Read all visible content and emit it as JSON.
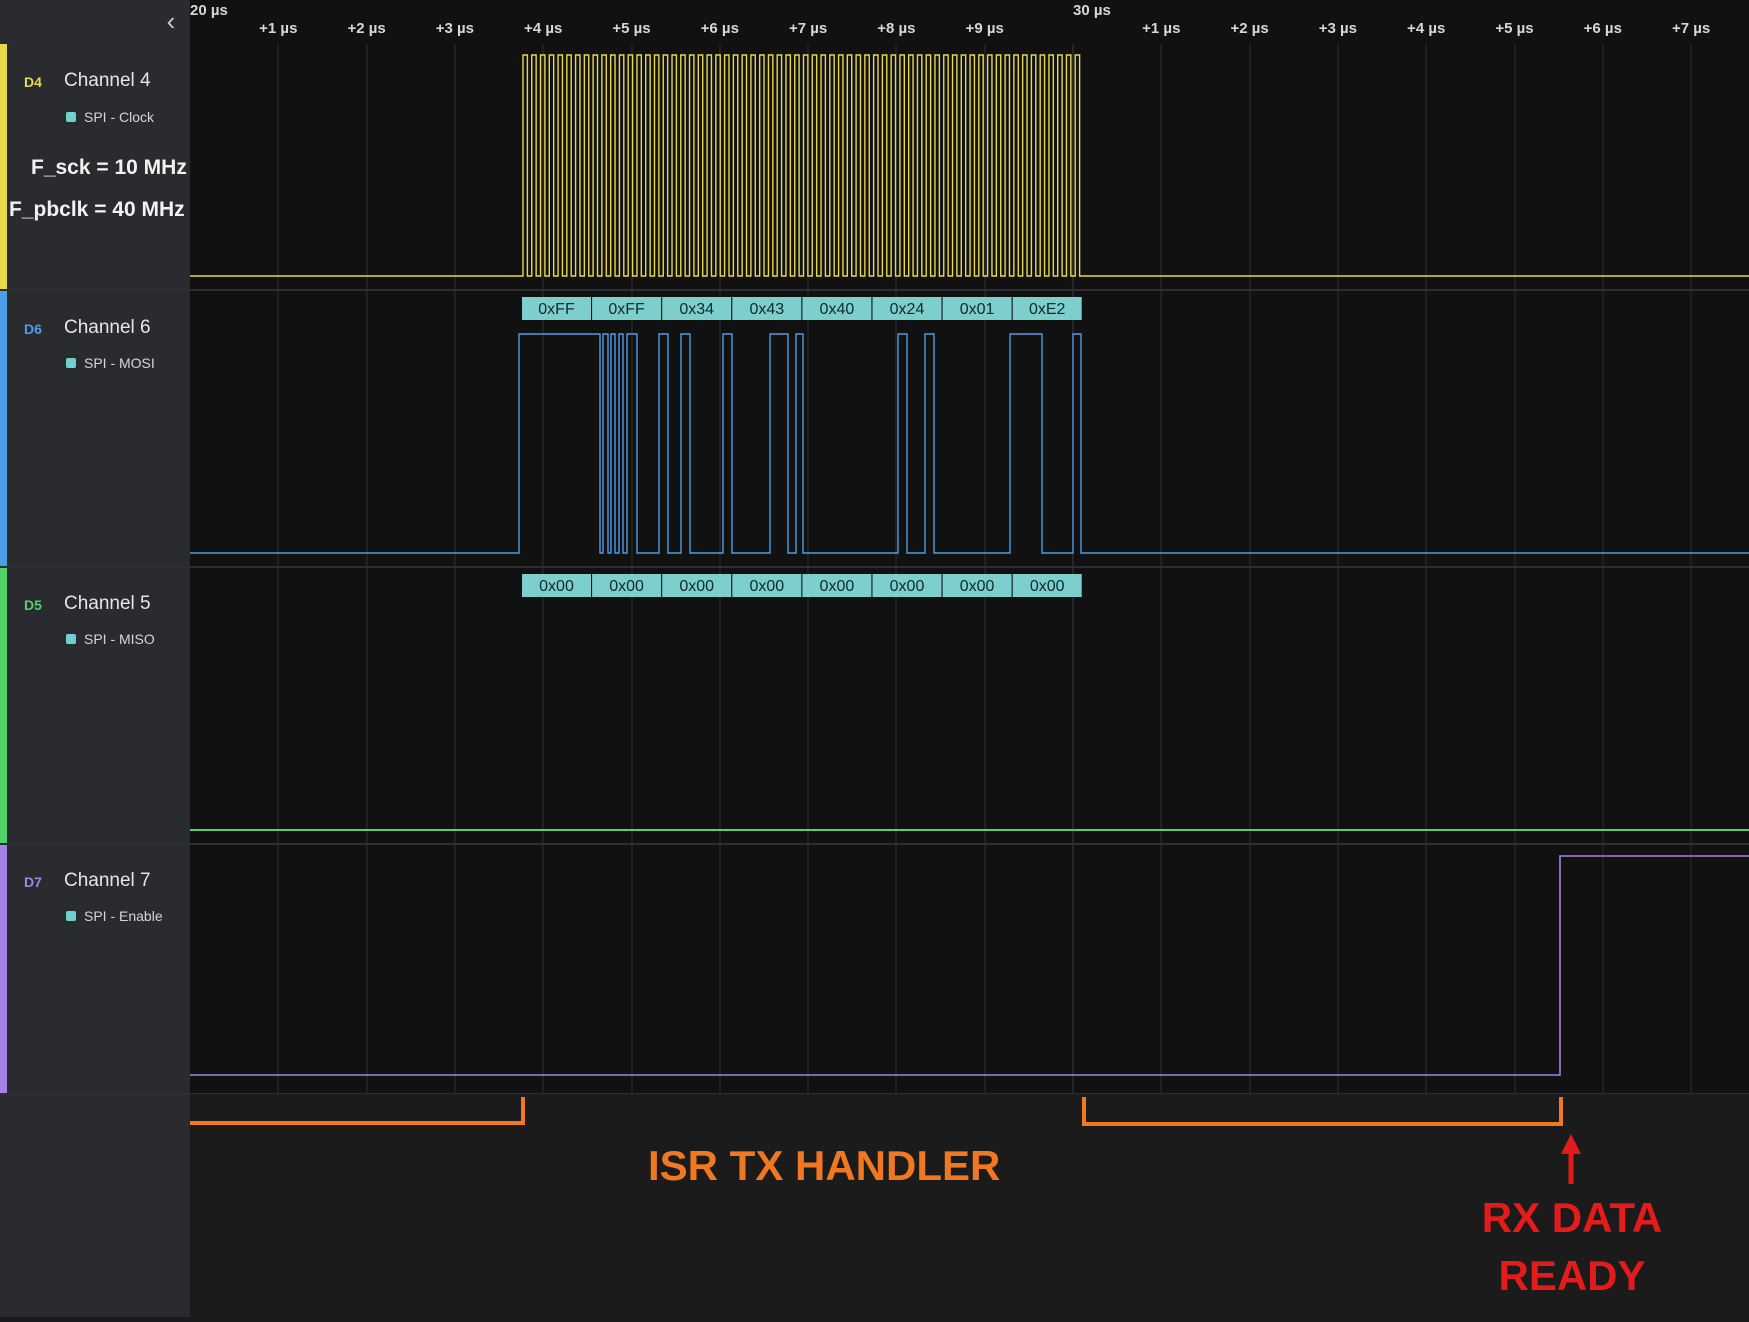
{
  "timeline": {
    "major_labels": [
      "20 µs",
      "30 µs"
    ],
    "minor_labels": [
      "+1 µs",
      "+2 µs",
      "+3 µs",
      "+4 µs",
      "+5 µs",
      "+6 µs",
      "+7 µs",
      "+8 µs",
      "+9 µs",
      "+1 µs",
      "+2 µs",
      "+3 µs",
      "+4 µs",
      "+5 µs",
      "+6 µs",
      "+7 µs"
    ]
  },
  "channels": [
    {
      "tag": "D4",
      "name": "Channel 4",
      "subtitle": "SPI - Clock",
      "color": "#e8d84a"
    },
    {
      "tag": "D6",
      "name": "Channel 6",
      "subtitle": "SPI - MOSI",
      "color": "#4e9de6"
    },
    {
      "tag": "D5",
      "name": "Channel 5",
      "subtitle": "SPI - MISO",
      "color": "#4fd36a"
    },
    {
      "tag": "D7",
      "name": "Channel 7",
      "subtitle": "SPI - Enable",
      "color": "#a383e6"
    }
  ],
  "notes": {
    "f_sck": "F_sck = 10 MHz",
    "f_pbclk": "F_pbclk = 40 MHz"
  },
  "decoded": {
    "mosi": [
      "0xFF",
      "0xFF",
      "0x34",
      "0x43",
      "0x40",
      "0x24",
      "0x01",
      "0xE2"
    ],
    "miso": [
      "0x00",
      "0x00",
      "0x00",
      "0x00",
      "0x00",
      "0x00",
      "0x00",
      "0x00"
    ]
  },
  "annotations": {
    "isr": "ISR TX HANDLER",
    "rx_line1": "RX DATA",
    "rx_line2": "READY",
    "isr_color": "#f07820",
    "rx_color": "#e31b1b"
  },
  "colors": {
    "decode_box": "#7ccfcc",
    "background": "#111112",
    "sidebar": "#2a2b2e"
  }
}
